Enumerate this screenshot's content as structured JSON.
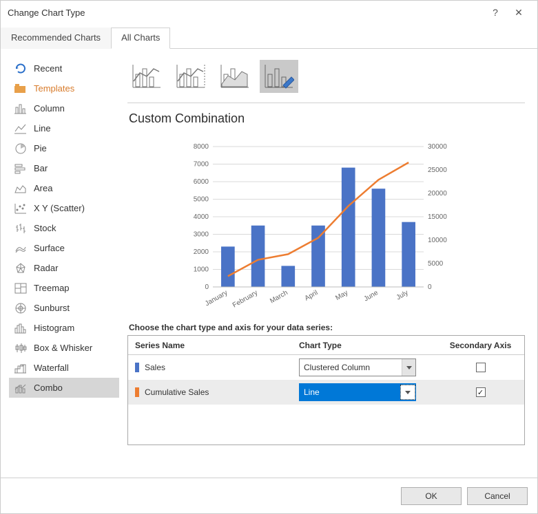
{
  "dialog": {
    "title": "Change Chart Type"
  },
  "tabs": {
    "recommended": "Recommended Charts",
    "all": "All Charts"
  },
  "sidebar": {
    "items": [
      {
        "label": "Recent"
      },
      {
        "label": "Templates"
      },
      {
        "label": "Column"
      },
      {
        "label": "Line"
      },
      {
        "label": "Pie"
      },
      {
        "label": "Bar"
      },
      {
        "label": "Area"
      },
      {
        "label": "X Y (Scatter)"
      },
      {
        "label": "Stock"
      },
      {
        "label": "Surface"
      },
      {
        "label": "Radar"
      },
      {
        "label": "Treemap"
      },
      {
        "label": "Sunburst"
      },
      {
        "label": "Histogram"
      },
      {
        "label": "Box & Whisker"
      },
      {
        "label": "Waterfall"
      },
      {
        "label": "Combo"
      }
    ],
    "selected": "Combo"
  },
  "preview": {
    "title": "Custom Combination"
  },
  "series_panel": {
    "instruction": "Choose the chart type and axis for your data series:",
    "headers": {
      "name": "Series Name",
      "type": "Chart Type",
      "axis": "Secondary Axis"
    },
    "rows": [
      {
        "name": "Sales",
        "swatch": "#4a73c6",
        "type": "Clustered Column",
        "secondary": false,
        "focused": false
      },
      {
        "name": "Cumulative Sales",
        "swatch": "#ed7d31",
        "type": "Line",
        "secondary": true,
        "focused": true
      }
    ]
  },
  "footer": {
    "ok": "OK",
    "cancel": "Cancel"
  },
  "chart_data": {
    "type": "combo",
    "categories": [
      "January",
      "February",
      "March",
      "April",
      "May",
      "June",
      "July"
    ],
    "series": [
      {
        "name": "Sales",
        "type": "bar",
        "axis": "primary",
        "values": [
          2300,
          3500,
          1200,
          3500,
          6800,
          5600,
          3700
        ]
      },
      {
        "name": "Cumulative Sales",
        "type": "line",
        "axis": "secondary",
        "values": [
          2300,
          5800,
          7000,
          10500,
          17300,
          22900,
          26600
        ]
      }
    ],
    "xlabel": "",
    "ylabel": "",
    "ylim": [
      0,
      8000
    ],
    "ylim2": [
      0,
      30000
    ],
    "yticks": [
      0,
      1000,
      2000,
      3000,
      4000,
      5000,
      6000,
      7000,
      8000
    ],
    "yticks2": [
      0,
      5000,
      10000,
      15000,
      20000,
      25000,
      30000
    ]
  },
  "colors": {
    "bar": "#4a73c6",
    "line": "#ed7d31"
  }
}
